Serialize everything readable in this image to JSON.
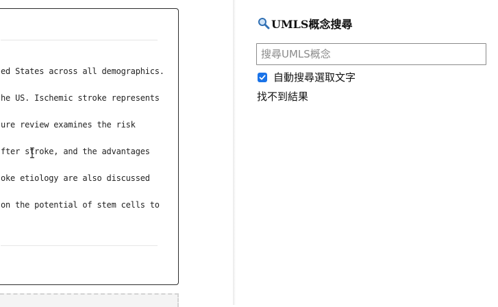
{
  "document": {
    "lines": [
      "ed States across all demographics.",
      "he US. Ischemic stroke represents",
      "ure review examines the risk",
      "fter stroke, and the advantages",
      "oke etiology are also discussed",
      "on the potential of stem cells to"
    ]
  },
  "umls_panel": {
    "title": "UMLS概念搜尋",
    "title_icon": "magnifier-icon",
    "search": {
      "placeholder": "搜尋UMLS概念",
      "value": ""
    },
    "auto_search": {
      "label": "自動搜尋選取文字",
      "checked": true
    },
    "result_text": "找不到結果"
  },
  "colors": {
    "checkbox_accent": "#1a73e8",
    "border": "#2b2b2b"
  }
}
